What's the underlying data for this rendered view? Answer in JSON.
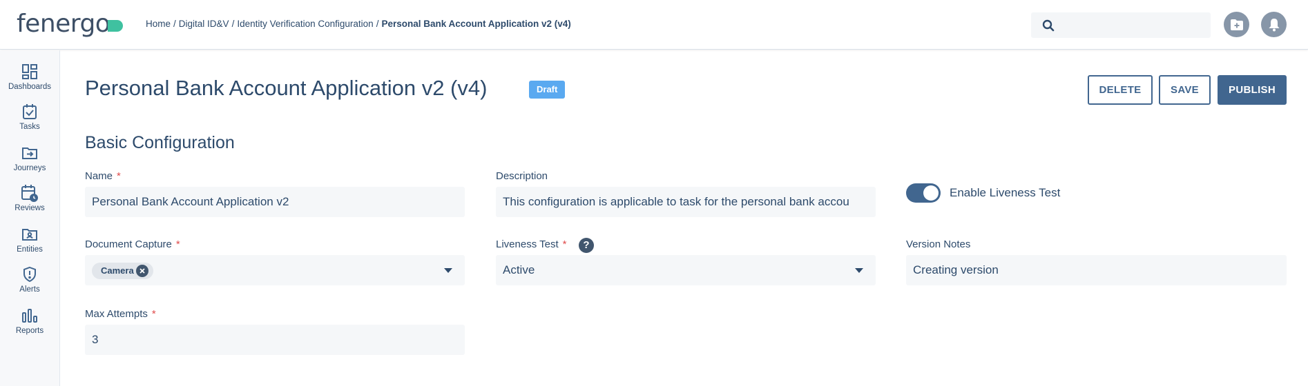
{
  "app": {
    "logo_text": "fenergo"
  },
  "breadcrumb": {
    "items": [
      "Home",
      "Digital ID&V",
      "Identity Verification Configuration"
    ],
    "separator": "/",
    "current": "Personal Bank Account Application v2 (v4)"
  },
  "header": {
    "search_placeholder": "",
    "icons": [
      "search-icon",
      "add-folder-icon",
      "bell-icon"
    ]
  },
  "sidebar": {
    "items": [
      {
        "label": "Dashboards",
        "icon": "dashboard-icon"
      },
      {
        "label": "Tasks",
        "icon": "task-check-icon"
      },
      {
        "label": "Journeys",
        "icon": "journey-folder-icon"
      },
      {
        "label": "Reviews",
        "icon": "calendar-clock-icon"
      },
      {
        "label": "Entities",
        "icon": "entity-folder-icon"
      },
      {
        "label": "Alerts",
        "icon": "shield-alert-icon"
      },
      {
        "label": "Reports",
        "icon": "bar-chart-icon"
      }
    ]
  },
  "page": {
    "title": "Personal Bank Account Application v2 (v4)",
    "status_badge": "Draft",
    "actions": {
      "delete": "DELETE",
      "save": "SAVE",
      "publish": "PUBLISH"
    },
    "section_title": "Basic Configuration"
  },
  "form": {
    "name": {
      "label": "Name",
      "required": "*",
      "value": "Personal Bank Account Application v2"
    },
    "description": {
      "label": "Description",
      "value": "This configuration is applicable to task for the personal bank accou"
    },
    "enable_liveness": {
      "label": "Enable Liveness Test",
      "on": true
    },
    "document_capture": {
      "label": "Document Capture",
      "required": "*",
      "chips": [
        "Camera"
      ]
    },
    "liveness_test": {
      "label": "Liveness Test",
      "required": "*",
      "value": "Active",
      "help": "?"
    },
    "version_notes": {
      "label": "Version Notes",
      "value": "Creating version"
    },
    "max_attempts": {
      "label": "Max Attempts",
      "required": "*",
      "value": "3"
    }
  },
  "colors": {
    "primary": "#41668f",
    "text": "#2d4a6b",
    "badge": "#5aa9f0",
    "required": "#e04c4c",
    "logo_accent": "#3fc1a0"
  }
}
